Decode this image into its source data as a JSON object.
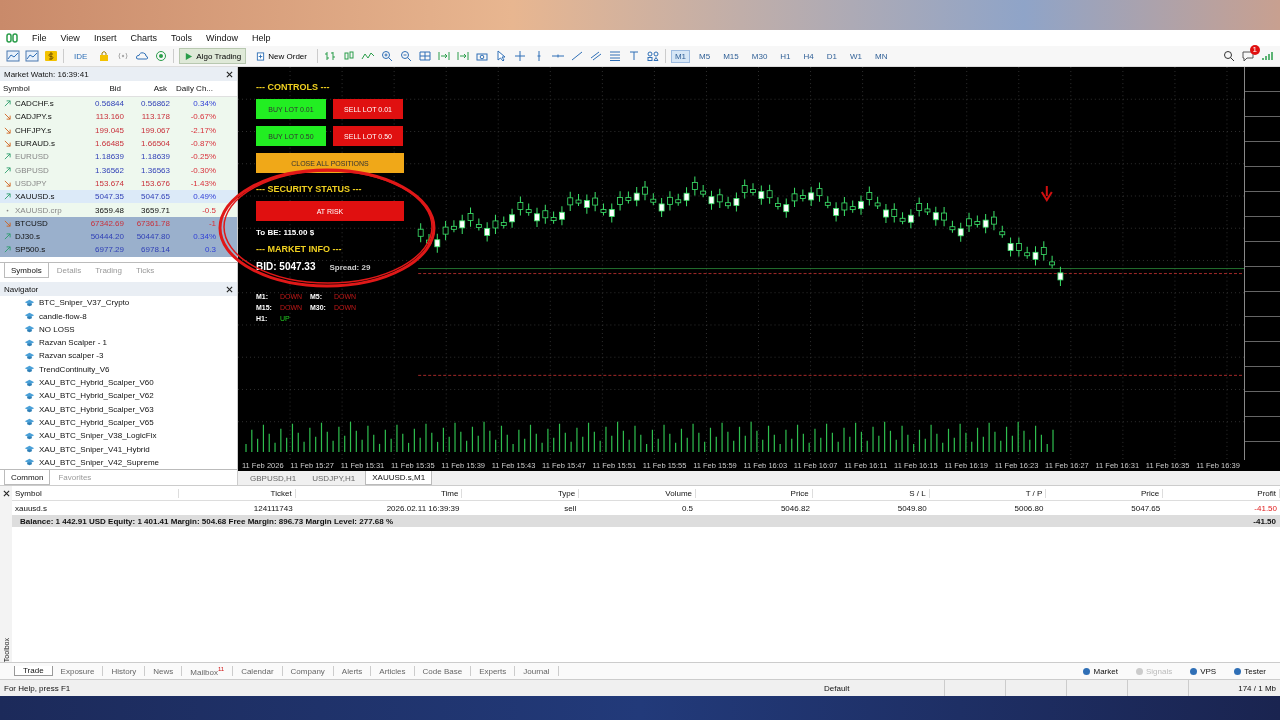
{
  "menu": [
    "File",
    "View",
    "Insert",
    "Charts",
    "Tools",
    "Window",
    "Help"
  ],
  "toolbar": {
    "ide": "IDE",
    "algo": "Algo Trading",
    "algo_on": true,
    "new_order": "New Order",
    "timeframes": [
      {
        "label": "M1",
        "selected": true
      },
      {
        "label": "M5",
        "selected": false
      },
      {
        "label": "M15",
        "selected": false
      },
      {
        "label": "M30",
        "selected": false
      },
      {
        "label": "H1",
        "selected": false
      },
      {
        "label": "H4",
        "selected": false
      },
      {
        "label": "D1",
        "selected": false
      },
      {
        "label": "W1",
        "selected": false
      },
      {
        "label": "MN",
        "selected": false
      }
    ],
    "notification_badge": "1"
  },
  "market_watch": {
    "title": "Market Watch: 16:39:41",
    "columns": [
      "Symbol",
      "Bid",
      "Ask",
      "Daily Ch..."
    ],
    "rows": [
      {
        "symbol": "CADCHF.s",
        "bid": "0.56844",
        "ask": "0.56862",
        "change": "0.34%",
        "rising": true,
        "flat": false,
        "change_positive": true,
        "dimmed": false,
        "active": false,
        "selected": false
      },
      {
        "symbol": "CADJPY.s",
        "bid": "113.160",
        "ask": "113.178",
        "change": "-0.67%",
        "rising": false,
        "flat": false,
        "change_positive": false,
        "dimmed": false,
        "active": false,
        "selected": false
      },
      {
        "symbol": "CHFJPY.s",
        "bid": "199.045",
        "ask": "199.067",
        "change": "-2.17%",
        "rising": false,
        "flat": false,
        "change_positive": false,
        "dimmed": false,
        "active": false,
        "selected": false
      },
      {
        "symbol": "EURAUD.s",
        "bid": "1.66485",
        "ask": "1.66504",
        "change": "-0.87%",
        "rising": false,
        "flat": false,
        "change_positive": false,
        "dimmed": false,
        "active": false,
        "selected": false
      },
      {
        "symbol": "EURUSD",
        "bid": "1.18639",
        "ask": "1.18639",
        "change": "-0.25%",
        "rising": true,
        "flat": false,
        "change_positive": false,
        "dimmed": true,
        "active": false,
        "selected": false
      },
      {
        "symbol": "GBPUSD",
        "bid": "1.36562",
        "ask": "1.36563",
        "change": "-0.30%",
        "rising": true,
        "flat": false,
        "change_positive": false,
        "dimmed": true,
        "active": false,
        "selected": false
      },
      {
        "symbol": "USDJPY",
        "bid": "153.674",
        "ask": "153.676",
        "change": "-1.43%",
        "rising": false,
        "flat": false,
        "change_positive": false,
        "dimmed": true,
        "active": false,
        "selected": false
      },
      {
        "symbol": "XAUUSD.s",
        "bid": "5047.35",
        "ask": "5047.65",
        "change": "0.49%",
        "rising": true,
        "flat": false,
        "change_positive": true,
        "dimmed": false,
        "active": true,
        "selected": false
      },
      {
        "symbol": "XAUUSD.crp",
        "bid": "3659.48",
        "ask": "3659.71",
        "change": "-0.5",
        "rising": false,
        "flat": true,
        "change_positive": false,
        "dimmed": true,
        "active": false,
        "selected": false
      },
      {
        "symbol": "BTCUSD",
        "bid": "67342.69",
        "ask": "67361.78",
        "change": "-1",
        "rising": false,
        "flat": false,
        "change_positive": false,
        "dimmed": false,
        "active": false,
        "selected": true
      },
      {
        "symbol": "DJ30.s",
        "bid": "50444.20",
        "ask": "50447.80",
        "change": "0.34%",
        "rising": true,
        "flat": false,
        "change_positive": true,
        "dimmed": false,
        "active": false,
        "selected": true
      },
      {
        "symbol": "SP500.s",
        "bid": "6977.29",
        "ask": "6978.14",
        "change": "0.3",
        "rising": true,
        "flat": false,
        "change_positive": true,
        "dimmed": false,
        "active": false,
        "selected": true
      }
    ],
    "tabs": [
      {
        "label": "Symbols",
        "selected": true
      },
      {
        "label": "Details",
        "selected": false
      },
      {
        "label": "Trading",
        "selected": false
      },
      {
        "label": "Ticks",
        "selected": false
      }
    ]
  },
  "navigator": {
    "title": "Navigator",
    "items": [
      "BTC_Sniper_V37_Crypto",
      "candle-flow-8",
      "NO LOSS",
      "Razvan Scalper - 1",
      "Razvan scalper -3",
      "TrendContinuity_V6",
      "XAU_BTC_Hybrid_Scalper_V60",
      "XAU_BTC_Hybrid_Scalper_V62",
      "XAU_BTC_Hybrid_Scalper_V63",
      "XAU_BTC_Hybrid_Scalper_V65",
      "XAU_BTC_Sniper_V38_LogicFix",
      "XAU_BTC_Sniper_V41_Hybrid",
      "XAU_BTC_Sniper_V42_Supreme"
    ],
    "tabs": [
      {
        "label": "Common",
        "selected": true
      },
      {
        "label": "Favorites",
        "selected": false
      }
    ]
  },
  "chart": {
    "time_labels": [
      "11 Feb 2026",
      "11 Feb 15:27",
      "11 Feb 15:31",
      "11 Feb 15:35",
      "11 Feb 15:39",
      "11 Feb 15:43",
      "11 Feb 15:47",
      "11 Feb 15:51",
      "11 Feb 15:55",
      "11 Feb 15:59",
      "11 Feb 16:03",
      "11 Feb 16:07",
      "11 Feb 16:11",
      "11 Feb 16:15",
      "11 Feb 16:19",
      "11 Feb 16:23",
      "11 Feb 16:27",
      "11 Feb 16:31",
      "11 Feb 16:35",
      "11 Feb 16:39"
    ],
    "panel": {
      "controls_title": "--- CONTROLS ---",
      "buttons": [
        {
          "label": "BUY LOT 0.01",
          "is_buy": true
        },
        {
          "label": "SELL LOT 0.01",
          "is_buy": false
        },
        {
          "label": "BUY LOT 0.50",
          "is_buy": true
        },
        {
          "label": "SELL LOT 0.50",
          "is_buy": false
        }
      ],
      "close_all": "CLOSE ALL POSITIONS",
      "security_title": "--- SECURITY STATUS ---",
      "status": "AT RISK",
      "at_risk": true,
      "to_be": "To BE: 115.00 $",
      "market_title": "--- MARKET INFO ---",
      "bid": "BID: 5047.33",
      "spread": "Spread: 29",
      "trends": [
        {
          "label": "M1:",
          "value": "DOWN",
          "up": false
        },
        {
          "label": "M5:",
          "value": "DOWN",
          "up": false
        },
        {
          "label": "M15:",
          "value": "DOWN",
          "up": false
        },
        {
          "label": "M30:",
          "value": "DOWN",
          "up": false
        },
        {
          "label": "H1:",
          "value": "UP",
          "up": true
        }
      ]
    }
  },
  "chart_tabs": [
    {
      "label": "GBPUSD,H1",
      "selected": false
    },
    {
      "label": "USDJPY,H1",
      "selected": false
    },
    {
      "label": "XAUUSD.s,M1",
      "selected": true
    }
  ],
  "trade": {
    "columns": [
      "Symbol",
      "Ticket",
      "Time",
      "Type",
      "Volume",
      "Price",
      "S / L",
      "T / P",
      "Price",
      "Profit"
    ],
    "rows": [
      {
        "cells": [
          "xauusd.s",
          "124111743",
          "2026.02.11 16:39:39",
          "sell",
          "0.5",
          "5046.82",
          "5049.80",
          "5006.80",
          "5047.65",
          "-41.50"
        ],
        "loss": true
      }
    ],
    "summary": "Balance: 1 442.91 USD  Equity: 1 401.41  Margin: 504.68  Free Margin: 896.73  Margin Level: 277.68 %",
    "summary_profit": "-41.50"
  },
  "toolbox_label": "Toolbox",
  "bottom_tabs": [
    {
      "label": "Trade",
      "selected": true
    },
    {
      "label": "Exposure",
      "selected": false
    },
    {
      "label": "History",
      "selected": false
    },
    {
      "label": "News",
      "selected": false
    },
    {
      "label": "Mailbox",
      "selected": false,
      "badge": "11"
    },
    {
      "label": "Calendar",
      "selected": false
    },
    {
      "label": "Company",
      "selected": false
    },
    {
      "label": "Alerts",
      "selected": false
    },
    {
      "label": "Articles",
      "selected": false
    },
    {
      "label": "Code Base",
      "selected": false
    },
    {
      "label": "Experts",
      "selected": false
    },
    {
      "label": "Journal",
      "selected": false
    }
  ],
  "services": [
    {
      "label": "Market",
      "disabled": false
    },
    {
      "label": "Signals",
      "disabled": true
    },
    {
      "label": "VPS",
      "disabled": false
    },
    {
      "label": "Tester",
      "disabled": false
    }
  ],
  "status_bar": {
    "help": "For Help, press F1",
    "profile": "Default",
    "traffic": "174 / 1 Mb"
  }
}
